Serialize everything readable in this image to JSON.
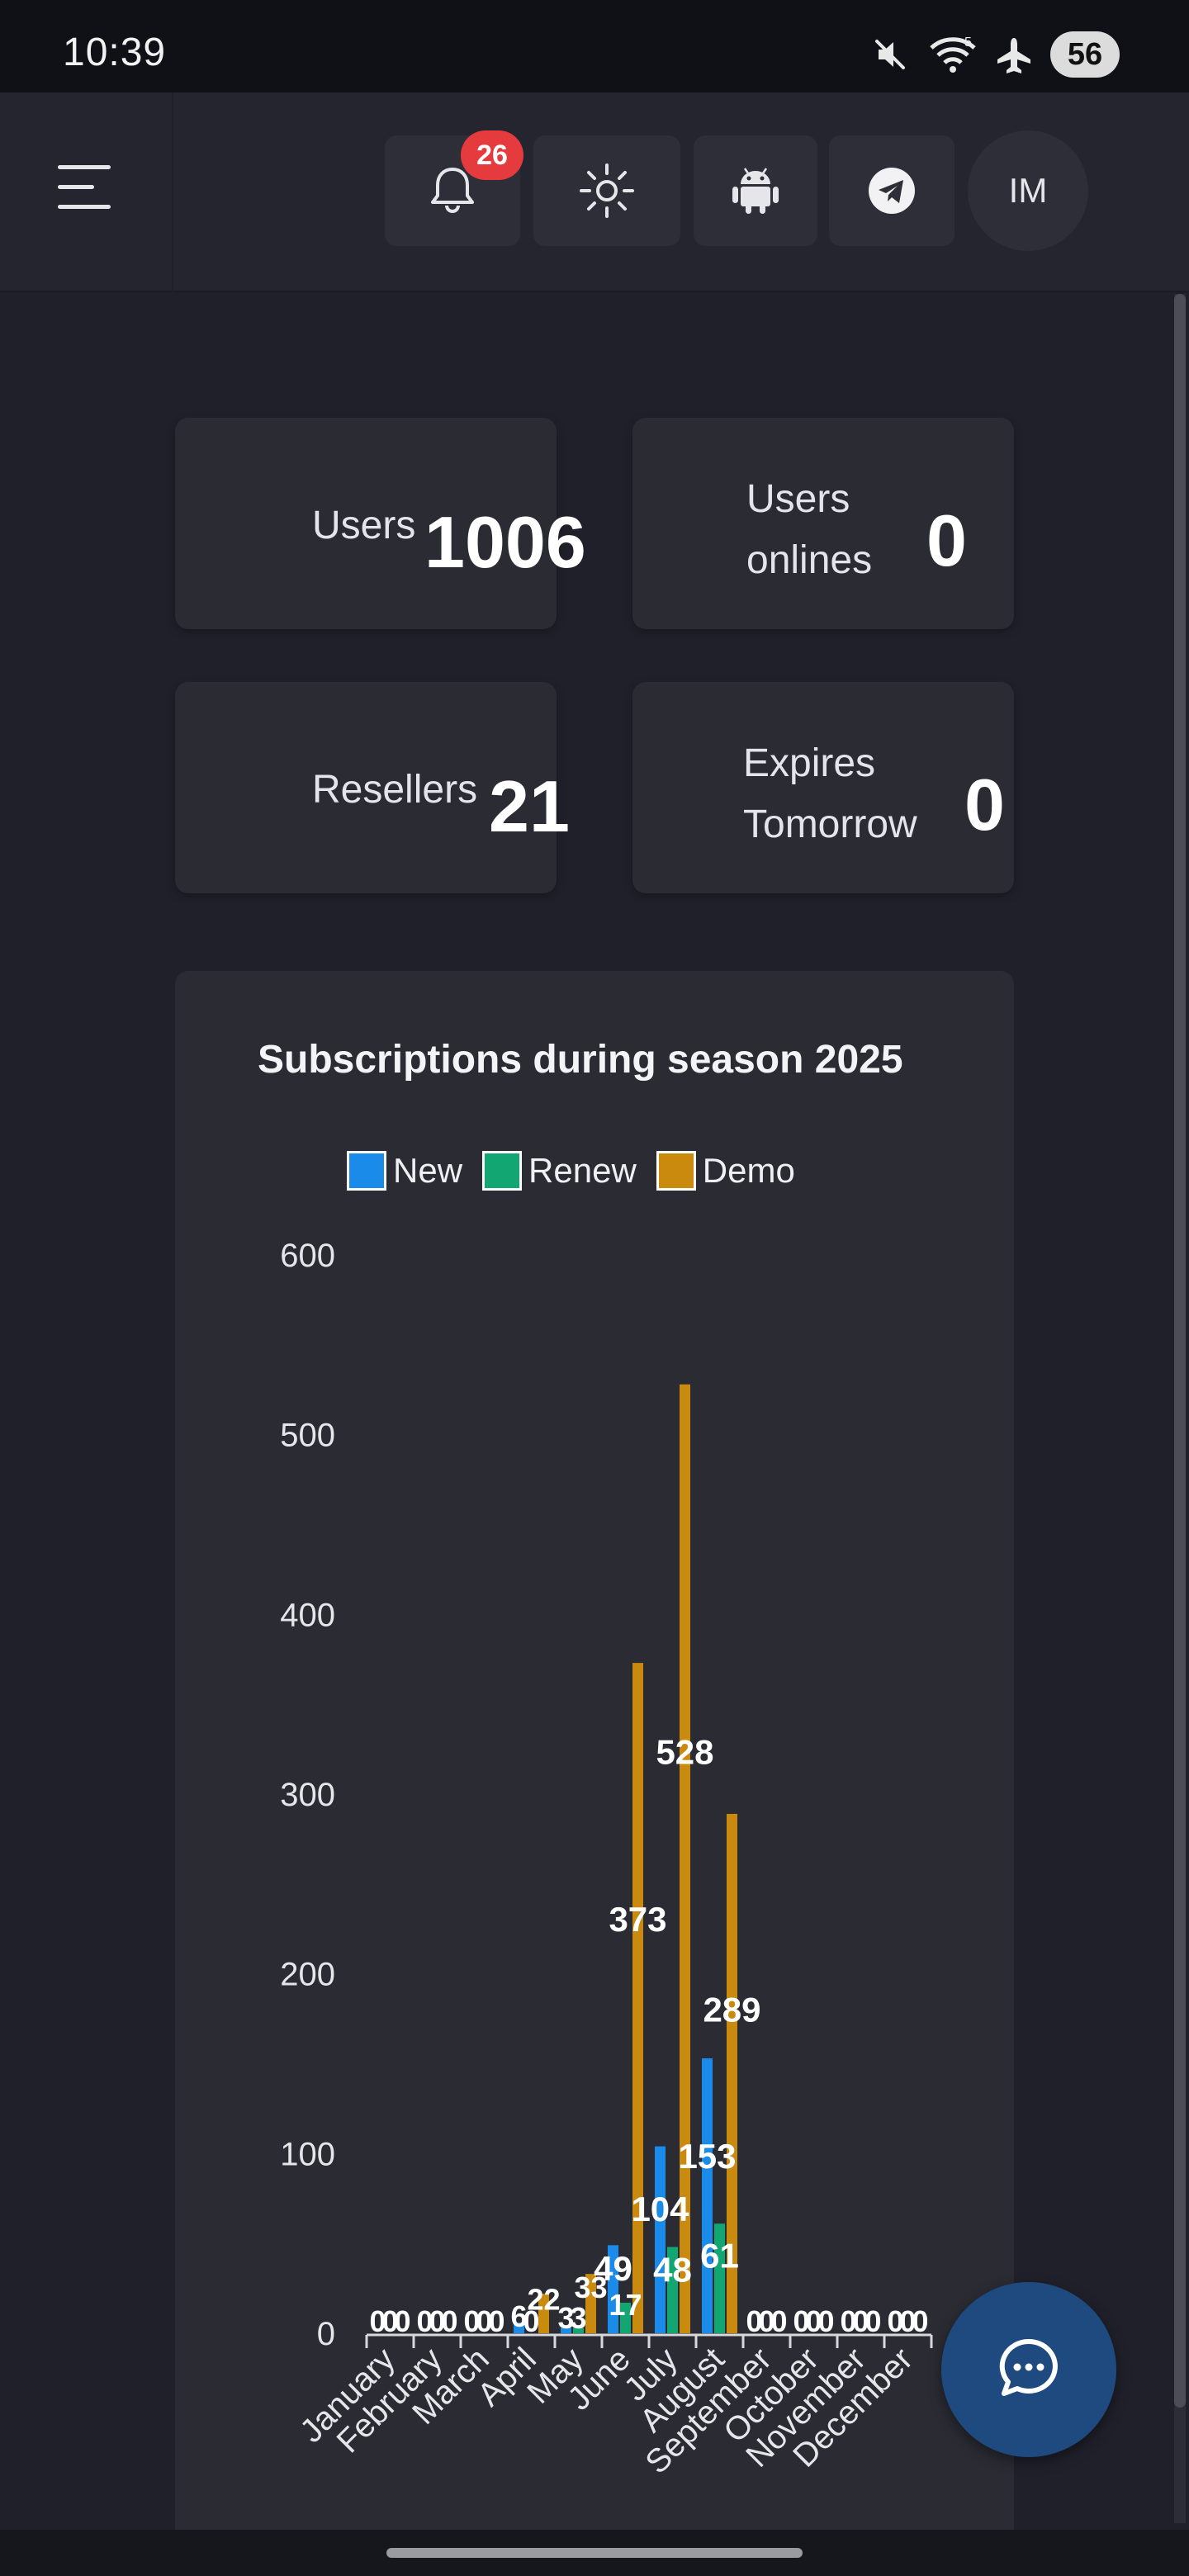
{
  "status_bar": {
    "time": "10:39",
    "battery": "56",
    "wifi_badge": "5",
    "icons": [
      "mute-icon",
      "wifi-icon",
      "airplane-icon"
    ]
  },
  "header": {
    "notification_count": "26",
    "avatar_initials": "IM",
    "buttons": [
      "menu-icon",
      "bell-icon",
      "sun-icon",
      "android-icon",
      "telegram-icon"
    ]
  },
  "stats": {
    "users": {
      "label": "Users",
      "value": "1006"
    },
    "users_online": {
      "label_line1": "Users",
      "label_line2": "onlines",
      "value": "0"
    },
    "resellers": {
      "label": "Resellers",
      "value": "21"
    },
    "expires": {
      "label_line1": "Expires",
      "label_line2": "Tomorrow",
      "value": "0"
    }
  },
  "chart_data": {
    "type": "bar",
    "title": "Subscriptions during season 2025",
    "categories": [
      "January",
      "February",
      "March",
      "April",
      "May",
      "June",
      "July",
      "August",
      "September",
      "October",
      "November",
      "December"
    ],
    "series": [
      {
        "name": "New",
        "color": "#1a8be8",
        "values": [
          0,
          0,
          0,
          6,
          3,
          49,
          104,
          153,
          0,
          0,
          0,
          0
        ]
      },
      {
        "name": "Renew",
        "color": "#12a673",
        "values": [
          0,
          0,
          0,
          0,
          3,
          17,
          48,
          61,
          0,
          0,
          0,
          0
        ]
      },
      {
        "name": "Demo",
        "color": "#c98a0e",
        "values": [
          0,
          0,
          0,
          22,
          33,
          373,
          528,
          289,
          0,
          0,
          0,
          0
        ]
      }
    ],
    "ylim": [
      0,
      600
    ],
    "yticks": [
      0,
      100,
      200,
      300,
      400,
      500,
      600
    ],
    "data_labels": true,
    "legend_position": "top",
    "grid": false
  }
}
